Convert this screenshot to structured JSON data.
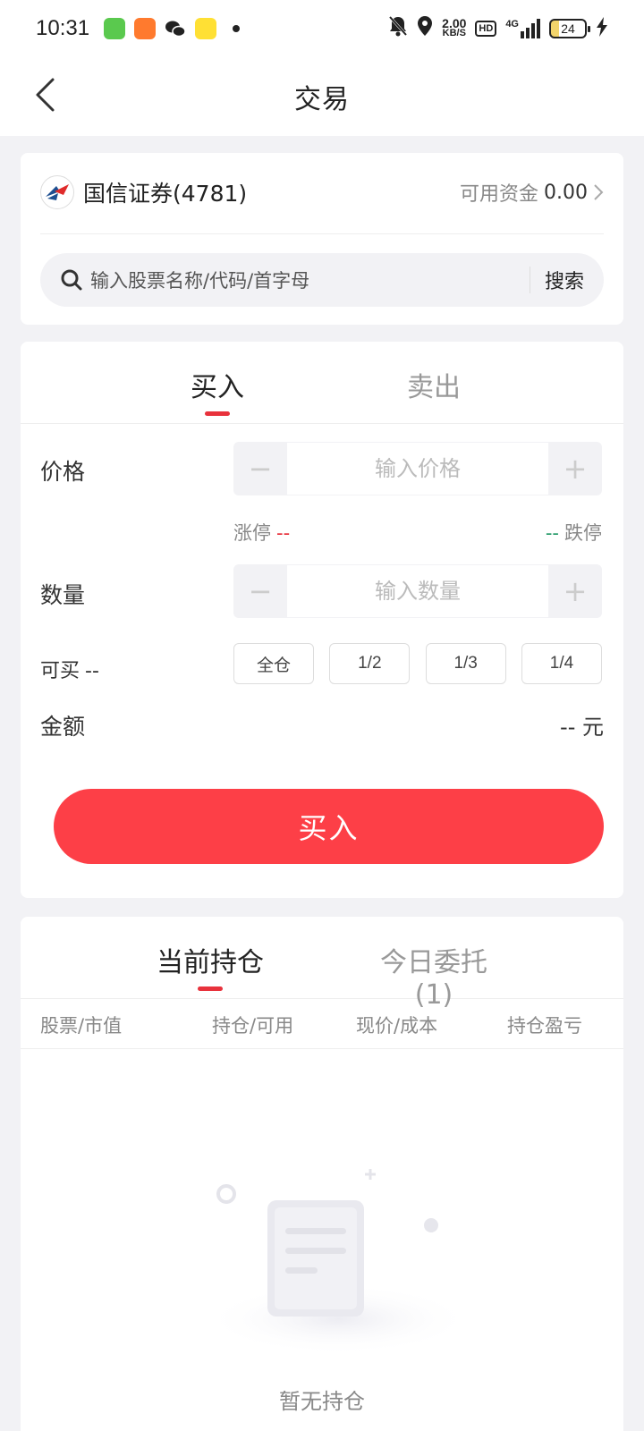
{
  "status_bar": {
    "time": "10:31",
    "net_speed_value": "2.00",
    "net_speed_unit": "KB/S",
    "hd": "HD",
    "network": "4G",
    "battery": "24"
  },
  "header": {
    "title": "交易"
  },
  "account": {
    "broker_name": "国信证券(4781)",
    "funds_label": "可用资金",
    "funds_value": "0.00",
    "search_placeholder": "输入股票名称/代码/首字母",
    "search_button": "搜索"
  },
  "trade": {
    "tabs": [
      {
        "label": "买入",
        "active": true
      },
      {
        "label": "卖出",
        "active": false
      }
    ],
    "price_label": "价格",
    "price_placeholder": "输入价格",
    "limit_up_label": "涨停",
    "limit_up_value": "--",
    "limit_down_label": "跌停",
    "limit_down_value": "--",
    "quantity_label": "数量",
    "quantity_placeholder": "输入数量",
    "minus": "−",
    "plus": "+",
    "can_buy_label": "可买",
    "can_buy_value": "--",
    "ratios": [
      "全仓",
      "1/2",
      "1/3",
      "1/4"
    ],
    "amount_label": "金额",
    "amount_value": "-- 元",
    "submit_label": "买入"
  },
  "holdings": {
    "tabs": [
      {
        "label": "当前持仓",
        "active": true
      },
      {
        "label": "今日委托(1)",
        "active": false
      }
    ],
    "columns": [
      "股票/市值",
      "持仓/可用",
      "现价/成本",
      "持仓盈亏"
    ],
    "empty_text": "暂无持仓"
  },
  "colors": {
    "accent_red": "#fd3f47",
    "tab_underline": "#e8323c",
    "limit_down_green": "#2a9d6c"
  }
}
